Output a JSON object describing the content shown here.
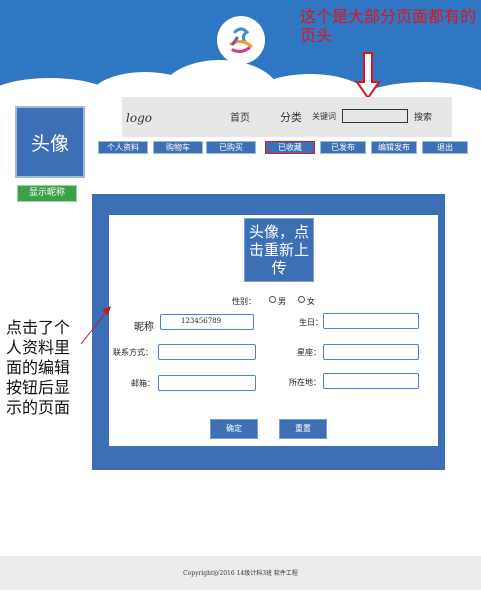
{
  "annotations": {
    "header_note": "这个是大部分页面都有的页头",
    "side_note": "点击了个人资料里面的编辑按钮后显示的页面"
  },
  "sketch": {
    "logo": "logo",
    "home": "首页",
    "category": "分类",
    "search_hint": "关键词",
    "search_button": "搜索"
  },
  "profile": {
    "avatar_label": "头像",
    "nickname_badge": "显示昵称"
  },
  "nav": {
    "items": [
      "个人资料",
      "购物车",
      "已购买",
      "已收藏",
      "已发布",
      "编辑发布",
      "退出"
    ]
  },
  "form": {
    "upload_avatar": "头像，点击重新上传",
    "gender_label": "性别：",
    "gender_options": [
      "男",
      "女"
    ],
    "nickname_label": "昵称",
    "nickname_value": "123456789",
    "birthday_label": "生日：",
    "contact_label": "联系方式：",
    "constellation_label": "星座：",
    "email_label": "邮箱：",
    "location_label": "所在地：",
    "confirm_button": "确定",
    "reset_button": "重置"
  },
  "footer": {
    "copyright": "Copyright@2016   14级计科3班   软件工程"
  },
  "colors": {
    "header_blue": "#2f76c3",
    "panel_blue": "#3d6fb5",
    "annotation_red": "#e0141a",
    "badge_green": "#3fa04a"
  }
}
